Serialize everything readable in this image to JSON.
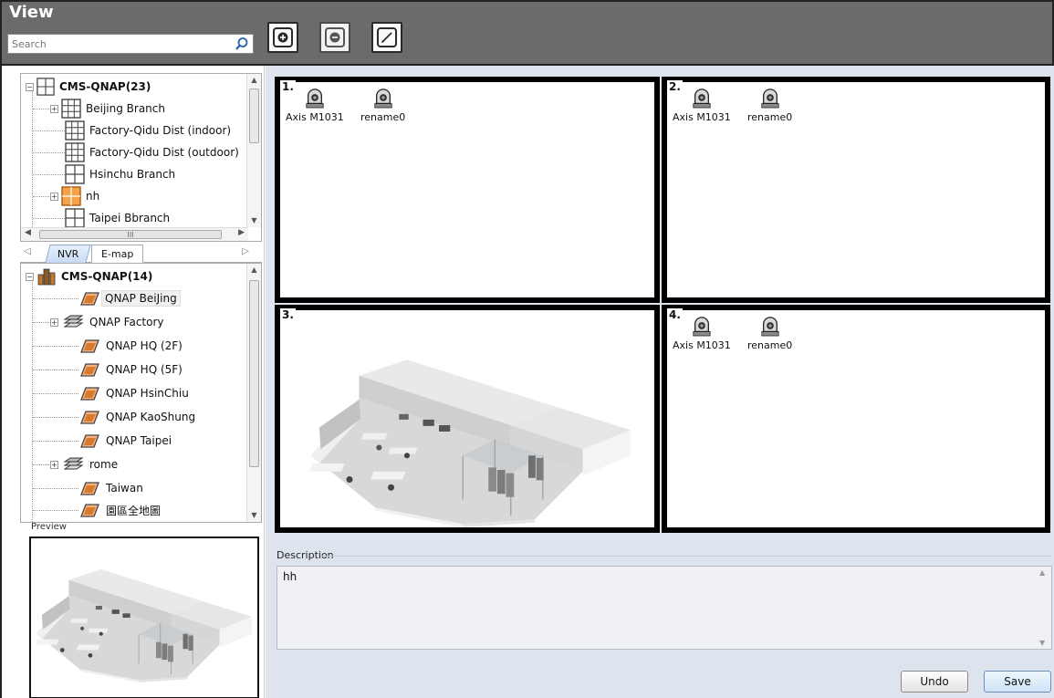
{
  "header": {
    "title": "View",
    "search_placeholder": "Search"
  },
  "toolbar": {
    "buttons": [
      {
        "name": "add-button",
        "icon": "plus-circle-icon"
      },
      {
        "name": "remove-button",
        "icon": "minus-circle-icon"
      },
      {
        "name": "edit-button",
        "icon": "pencil-icon"
      }
    ]
  },
  "nvr_tree": {
    "root": "CMS-QNAP(23)",
    "items": [
      "Beijing Branch",
      "Factory-Qidu Dist  (indoor)",
      "Factory-Qidu Dist  (outdoor)",
      "Hsinchu Branch",
      "nh",
      "Taipei Bbranch"
    ],
    "hscroll_label": "III"
  },
  "tabs": {
    "nvr": "NVR",
    "emap": "E-map"
  },
  "emap_tree": {
    "root": "CMS-QNAP(14)",
    "items": [
      "QNAP BeiJing",
      "QNAP Factory",
      "QNAP HQ (2F)",
      "QNAP HQ (5F)",
      "QNAP HsinChiu",
      "QNAP KaoShung",
      "QNAP Taipei",
      "rome",
      "Taiwan",
      "園區全地圖"
    ]
  },
  "preview": {
    "label": "Preview"
  },
  "layout": {
    "cells": [
      {
        "number": "1.",
        "cameras": [
          "Axis M1031",
          "rename0"
        ]
      },
      {
        "number": "2.",
        "cameras": [
          "Axis M1031",
          "rename0"
        ]
      },
      {
        "number": "3.",
        "image": "office-floorplan-3d"
      },
      {
        "number": "4.",
        "cameras": [
          "Axis M1031",
          "rename0"
        ]
      }
    ]
  },
  "description": {
    "label": "Description",
    "text": "hh"
  },
  "actions": {
    "undo": "Undo",
    "save": "Save"
  },
  "colors": {
    "header_bg": "#6b6b6b",
    "right_bg": "#dde4ee",
    "cell_border": "#000000",
    "tab_active": "#c7daf3"
  }
}
